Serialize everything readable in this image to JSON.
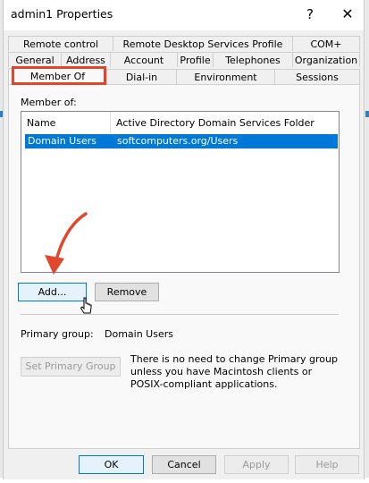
{
  "window": {
    "title": "admin1 Properties",
    "help_glyph": "?",
    "close_glyph": "✕"
  },
  "tabs": {
    "row1": [
      "Remote control",
      "Remote Desktop Services Profile",
      "COM+"
    ],
    "row2": [
      "General",
      "Address",
      "Account",
      "Profile",
      "Telephones",
      "Organization"
    ],
    "row3": [
      "Member Of",
      "Dial-in",
      "Environment",
      "Sessions"
    ],
    "active": "Member Of"
  },
  "member_of": {
    "label": "Member of:",
    "columns": [
      "Name",
      "Active Directory Domain Services Folder"
    ],
    "rows": [
      {
        "name": "Domain Users",
        "folder": "softcomputers.org/Users",
        "selected": true
      }
    ]
  },
  "buttons": {
    "add": "Add...",
    "remove": "Remove",
    "set_primary": "Set Primary Group",
    "ok": "OK",
    "cancel": "Cancel",
    "apply": "Apply",
    "help": "Help"
  },
  "primary_group": {
    "label": "Primary group:",
    "value": "Domain Users",
    "info": "There is no need to change Primary group unless you have Macintosh clients or POSIX-compliant applications."
  },
  "colors": {
    "annotation": "#e0472c",
    "selection": "#0078d7"
  },
  "icons": [
    "help-icon",
    "close-icon",
    "annotation-arrow-icon",
    "mouse-cursor-icon"
  ]
}
